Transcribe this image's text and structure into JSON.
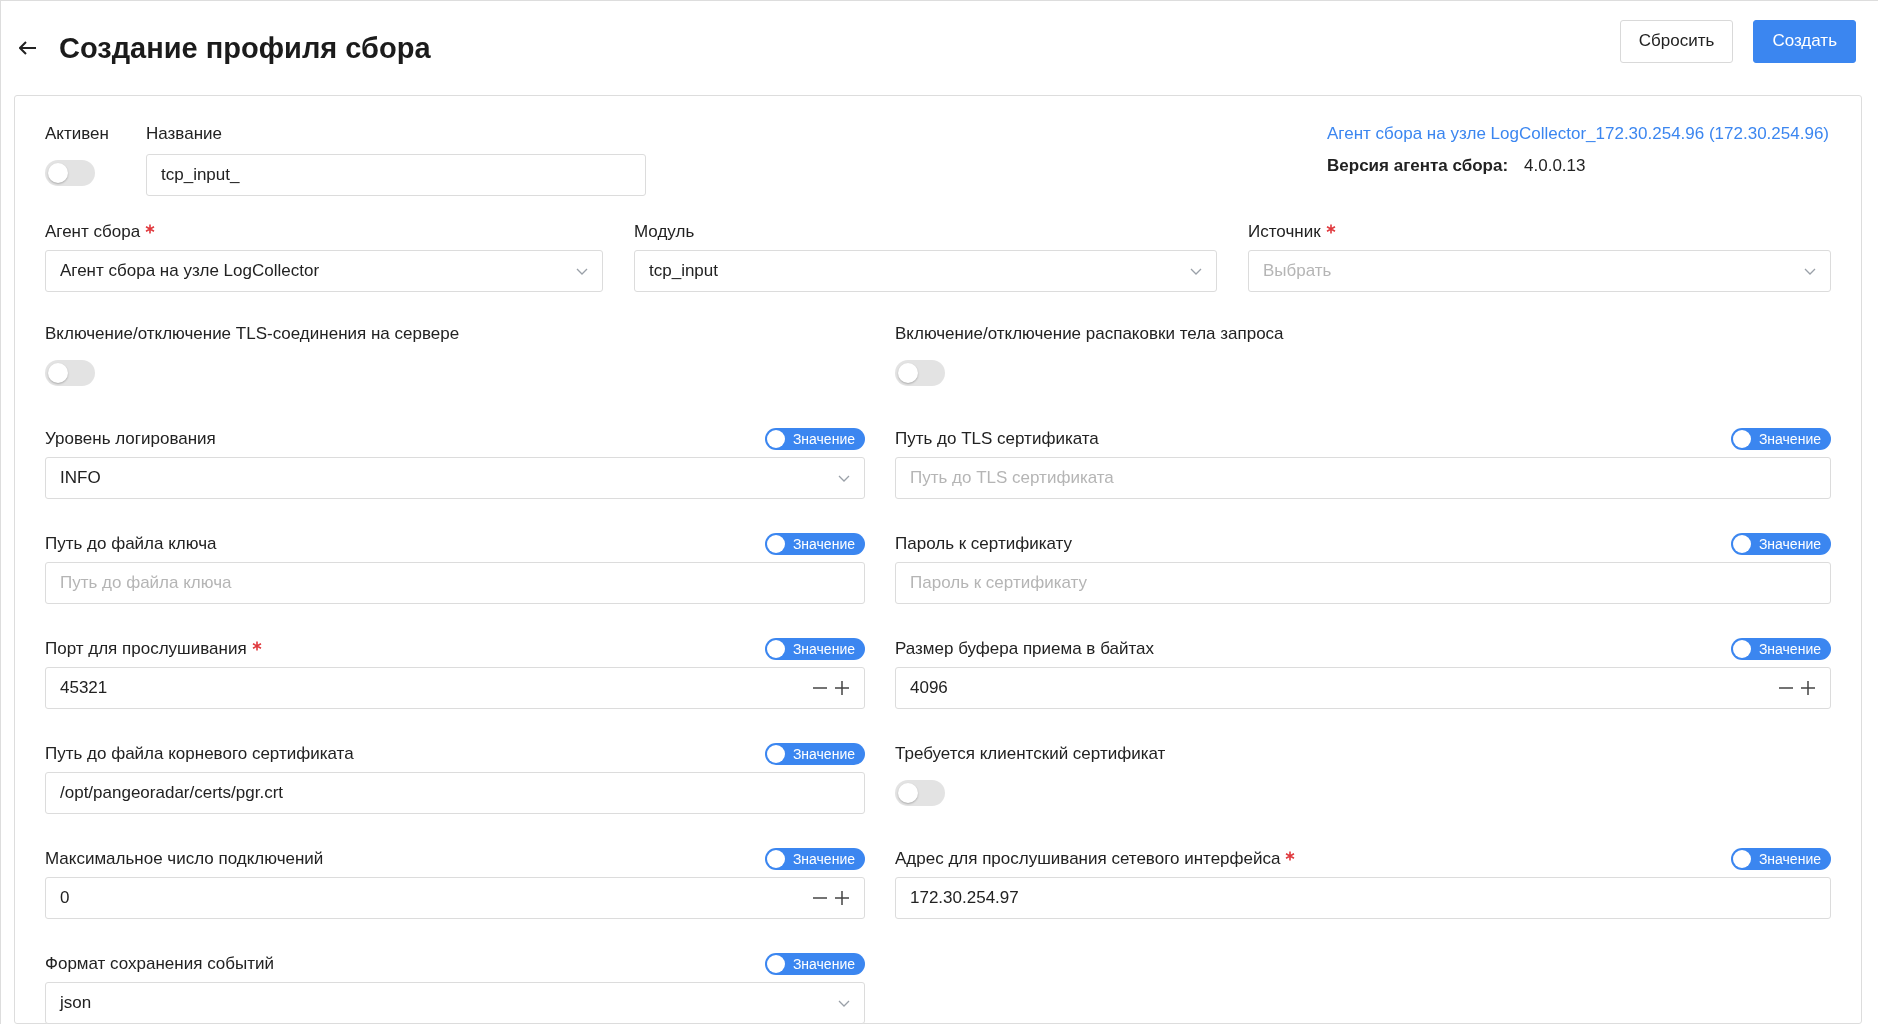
{
  "header": {
    "title": "Создание профиля сбора",
    "buttons": [
      {
        "label": "Сбросить",
        "kind": "secondary"
      },
      {
        "label": "Создать",
        "kind": "primary"
      }
    ]
  },
  "general": {
    "active": {
      "label": "Активен",
      "on": false
    },
    "name": {
      "label": "Название",
      "value": "tcp_input_"
    },
    "agent_link": "Агент сбора на узле LogCollector_172.30.254.96 (172.30.254.96)",
    "agent_version": {
      "label": "Версия агента сбора:",
      "value": "4.0.0.13"
    }
  },
  "selectors": [
    {
      "label": "Агент сбора",
      "required": true,
      "value": "Агент сбора на узле LogCollector"
    },
    {
      "label": "Модуль",
      "required": false,
      "value": "tcp_input"
    },
    {
      "label": "Источник",
      "required": true,
      "placeholder": "Выбрать"
    }
  ],
  "fields": [
    {
      "kind": "toggle",
      "label": "Включение/отключение TLS-соединения на сервере",
      "required": false,
      "on": false
    },
    {
      "kind": "toggle",
      "label": "Включение/отключение распаковки тела запроса",
      "required": false,
      "on": false
    },
    {
      "kind": "select",
      "label": "Уровень логирования",
      "required": false,
      "value": "INFO",
      "value_switch": {
        "label": "Значение",
        "on": true
      }
    },
    {
      "kind": "text",
      "label": "Путь до TLS сертификата",
      "required": false,
      "placeholder": "Путь до TLS сертификата",
      "value_switch": {
        "label": "Значение",
        "on": true
      }
    },
    {
      "kind": "text",
      "label": "Путь до файла ключа",
      "required": false,
      "placeholder": "Путь до файла ключа",
      "value_switch": {
        "label": "Значение",
        "on": true
      }
    },
    {
      "kind": "text",
      "label": "Пароль к сертификату",
      "required": false,
      "placeholder": "Пароль к сертификату",
      "value_switch": {
        "label": "Значение",
        "on": true
      }
    },
    {
      "kind": "number",
      "label": "Порт для прослушивания",
      "required": true,
      "value": "45321",
      "value_switch": {
        "label": "Значение",
        "on": true
      }
    },
    {
      "kind": "number",
      "label": "Размер буфера приема в байтах",
      "required": false,
      "value": "4096",
      "value_switch": {
        "label": "Значение",
        "on": true
      }
    },
    {
      "kind": "text",
      "label": "Путь до файла корневого сертификата",
      "required": false,
      "value": "/opt/pangeoradar/certs/pgr.crt",
      "value_switch": {
        "label": "Значение",
        "on": true
      }
    },
    {
      "kind": "toggle",
      "label": "Требуется клиентский сертификат",
      "required": false,
      "on": false
    },
    {
      "kind": "number",
      "label": "Максимальное число подключений",
      "required": false,
      "value": "0",
      "value_switch": {
        "label": "Значение",
        "on": true
      }
    },
    {
      "kind": "text",
      "label": "Адрес для прослушивания сетевого интерфейса",
      "required": true,
      "value": "172.30.254.97",
      "value_switch": {
        "label": "Значение",
        "on": true
      }
    },
    {
      "kind": "select",
      "label": "Формат сохранения событий",
      "required": false,
      "value": "json",
      "value_switch": {
        "label": "Значение",
        "on": true
      }
    }
  ]
}
